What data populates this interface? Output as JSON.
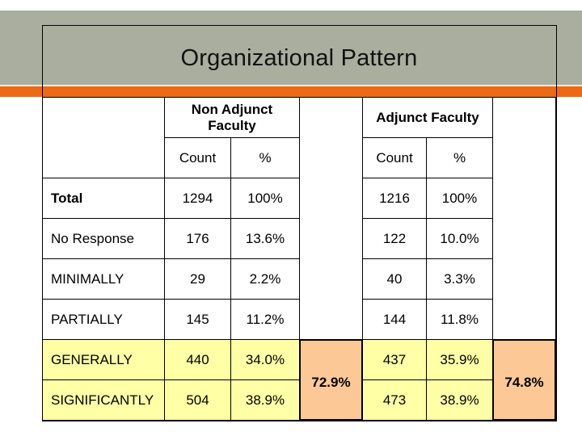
{
  "slide": {
    "title": "Organizational Pattern",
    "colors": {
      "header_band": "#a9ae9f",
      "accent_stripe": "#ec6a15",
      "highlight_row": "#ffffa6",
      "summary_cell": "#fcc996"
    }
  },
  "table": {
    "groups": [
      {
        "label": "Non Adjunct Faculty",
        "columns": [
          "Count",
          "%"
        ]
      },
      {
        "label": "Adjunct Faculty",
        "columns": [
          "Count",
          "%"
        ]
      }
    ],
    "rows": [
      {
        "label": "Total",
        "non_adjunct_count": "1294",
        "non_adjunct_pct": "100%",
        "adjunct_count": "1216",
        "adjunct_pct": "100%"
      },
      {
        "label": "No Response",
        "non_adjunct_count": "176",
        "non_adjunct_pct": "13.6%",
        "adjunct_count": "122",
        "adjunct_pct": "10.0%"
      },
      {
        "label": "MINIMALLY",
        "non_adjunct_count": "29",
        "non_adjunct_pct": "2.2%",
        "adjunct_count": "40",
        "adjunct_pct": "3.3%"
      },
      {
        "label": "PARTIALLY",
        "non_adjunct_count": "145",
        "non_adjunct_pct": "11.2%",
        "adjunct_count": "144",
        "adjunct_pct": "11.8%"
      },
      {
        "label": "GENERALLY",
        "non_adjunct_count": "440",
        "non_adjunct_pct": "34.0%",
        "adjunct_count": "437",
        "adjunct_pct": "35.9%"
      },
      {
        "label": "SIGNIFICANTLY",
        "non_adjunct_count": "504",
        "non_adjunct_pct": "38.9%",
        "adjunct_count": "473",
        "adjunct_pct": "38.9%"
      }
    ],
    "combined": {
      "non_adjunct": "72.9%",
      "adjunct": "74.8%"
    }
  }
}
